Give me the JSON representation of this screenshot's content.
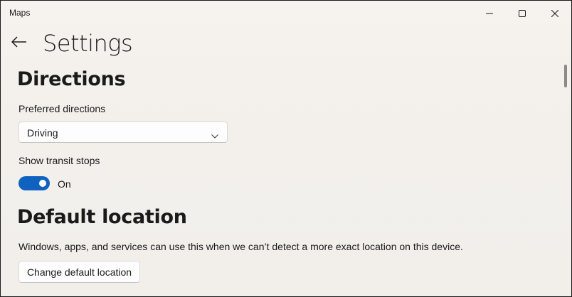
{
  "window": {
    "app_title": "Maps",
    "controls": {
      "minimize_icon": "minimize-icon",
      "maximize_icon": "maximize-icon",
      "close_icon": "close-icon"
    }
  },
  "header": {
    "back_icon": "back-arrow-icon",
    "title": "Settings"
  },
  "directions": {
    "heading": "Directions",
    "preferred_label": "Preferred directions",
    "preferred_value": "Driving",
    "transit_label": "Show transit stops",
    "transit_toggle_on": true,
    "transit_state": "On"
  },
  "default_location": {
    "heading": "Default location",
    "description": "Windows, apps, and services can use this when we can’t detect a more exact location on this device.",
    "button_label": "Change default location"
  },
  "colors": {
    "accent": "#0f62c0",
    "background": "#f4f1ed",
    "text": "#1a1a1a"
  }
}
